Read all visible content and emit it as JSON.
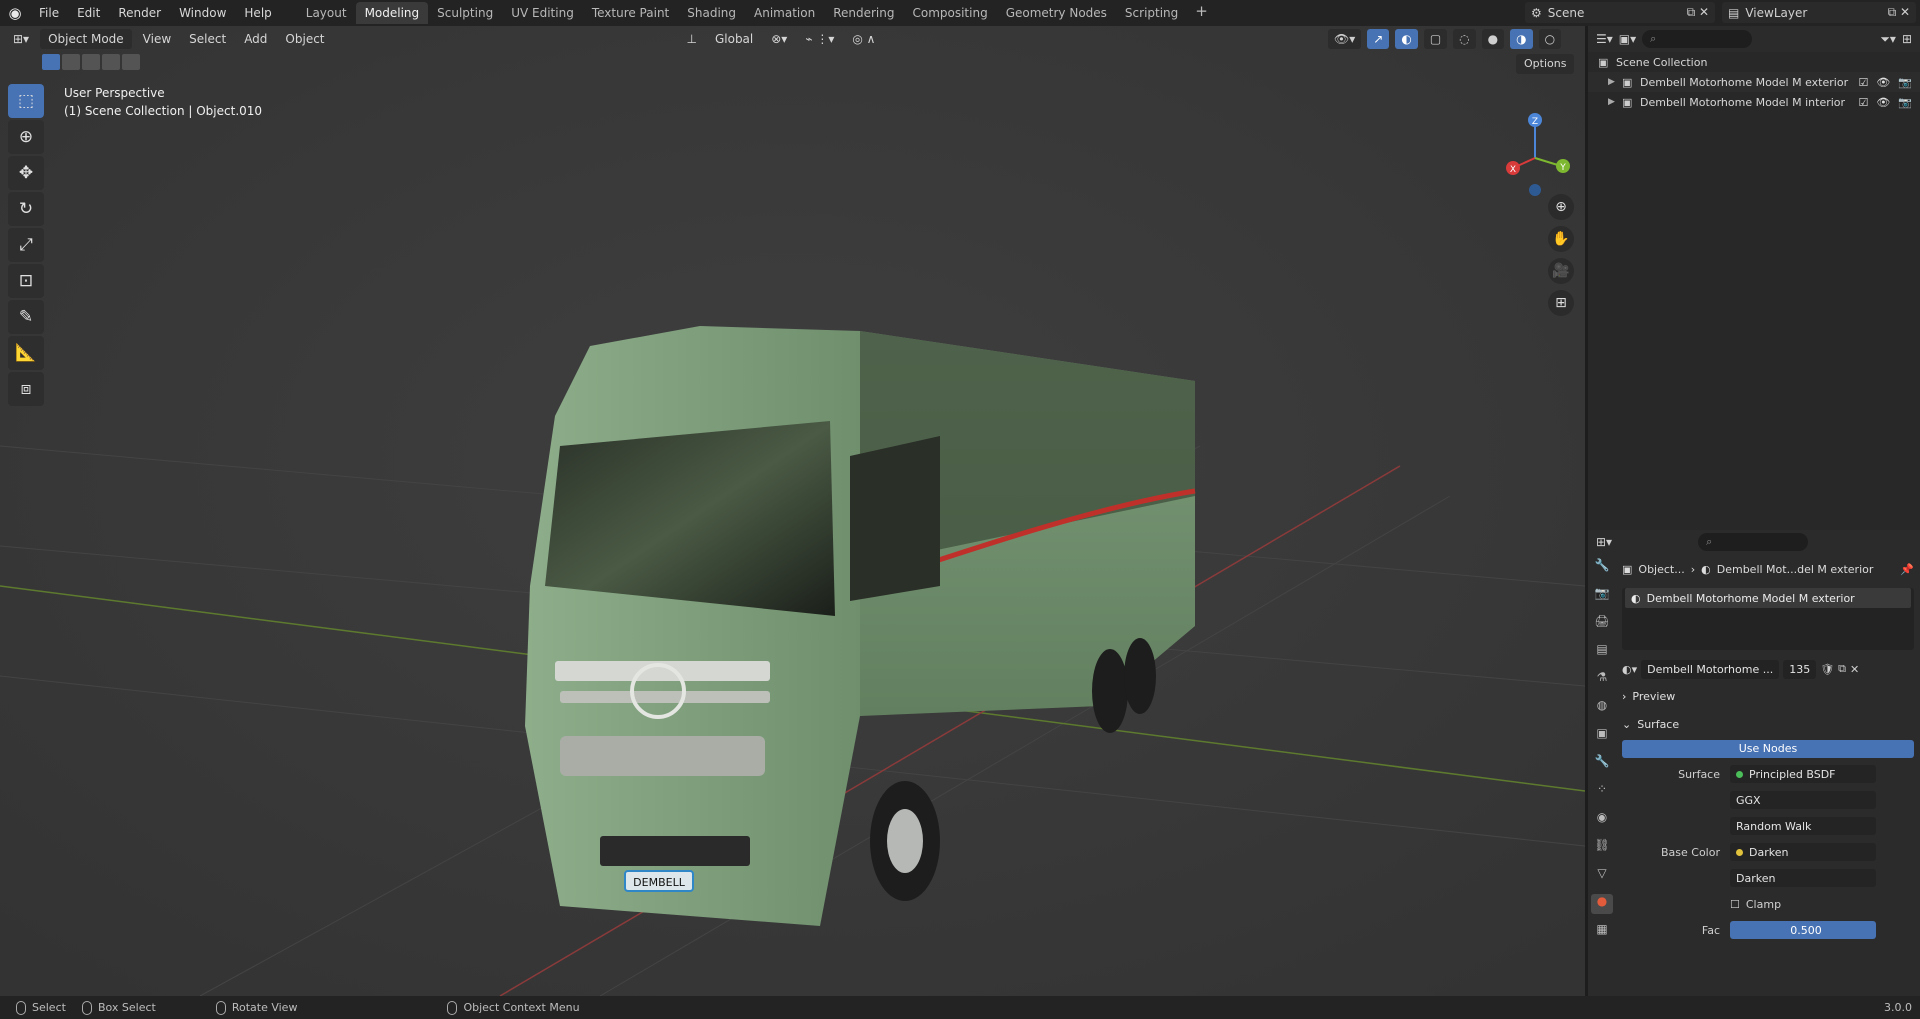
{
  "menubar": {
    "items": [
      "File",
      "Edit",
      "Render",
      "Window",
      "Help"
    ]
  },
  "workspaces": [
    "Layout",
    "Modeling",
    "Sculpting",
    "UV Editing",
    "Texture Paint",
    "Shading",
    "Animation",
    "Rendering",
    "Compositing",
    "Geometry Nodes",
    "Scripting"
  ],
  "active_workspace": "Modeling",
  "scene": {
    "label": "Scene"
  },
  "view_layer": {
    "label": "ViewLayer"
  },
  "viewport": {
    "mode": "Object Mode",
    "menus": [
      "View",
      "Select",
      "Add",
      "Object"
    ],
    "transform_orientation": "Global",
    "options_label": "Options",
    "info_line1": "User Perspective",
    "info_line2": "(1) Scene Collection | Object.010",
    "gizmo_axes": {
      "x": "X",
      "y": "Y",
      "z": "Z"
    },
    "plate_text": "DEMBELL"
  },
  "outliner": {
    "search_icon": "search-icon",
    "rows": [
      {
        "label": "Scene Collection"
      },
      {
        "label": "Dembell Motorhome Model M exterior"
      },
      {
        "label": "Dembell Motorhome Model M  interior"
      }
    ]
  },
  "properties": {
    "breadcrumb_object": "Object...",
    "breadcrumb_material": "Dembell Mot...del M exterior",
    "slot_name": "Dembell Motorhome Model M exterior",
    "material_name": "Dembell Motorhome ...",
    "material_users": "135",
    "preview_label": "Preview",
    "surface_section": "Surface",
    "use_nodes_label": "Use Nodes",
    "surface_label": "Surface",
    "surface_value": "Principled BSDF",
    "distribution": "GGX",
    "subsurface": "Random Walk",
    "base_color_label": "Base Color",
    "base_color_value": "Darken",
    "blend_mode": "Darken",
    "clamp_label": "Clamp",
    "fac_label": "Fac",
    "fac_value": "0.500"
  },
  "statusbar": {
    "select": "Select",
    "box_select": "Box Select",
    "rotate_view": "Rotate View",
    "context_menu": "Object Context Menu",
    "version": "3.0.0"
  },
  "colors": {
    "accent": "#4772b3",
    "truck_body": "#7a9a78",
    "stripe": "#c0302a"
  }
}
